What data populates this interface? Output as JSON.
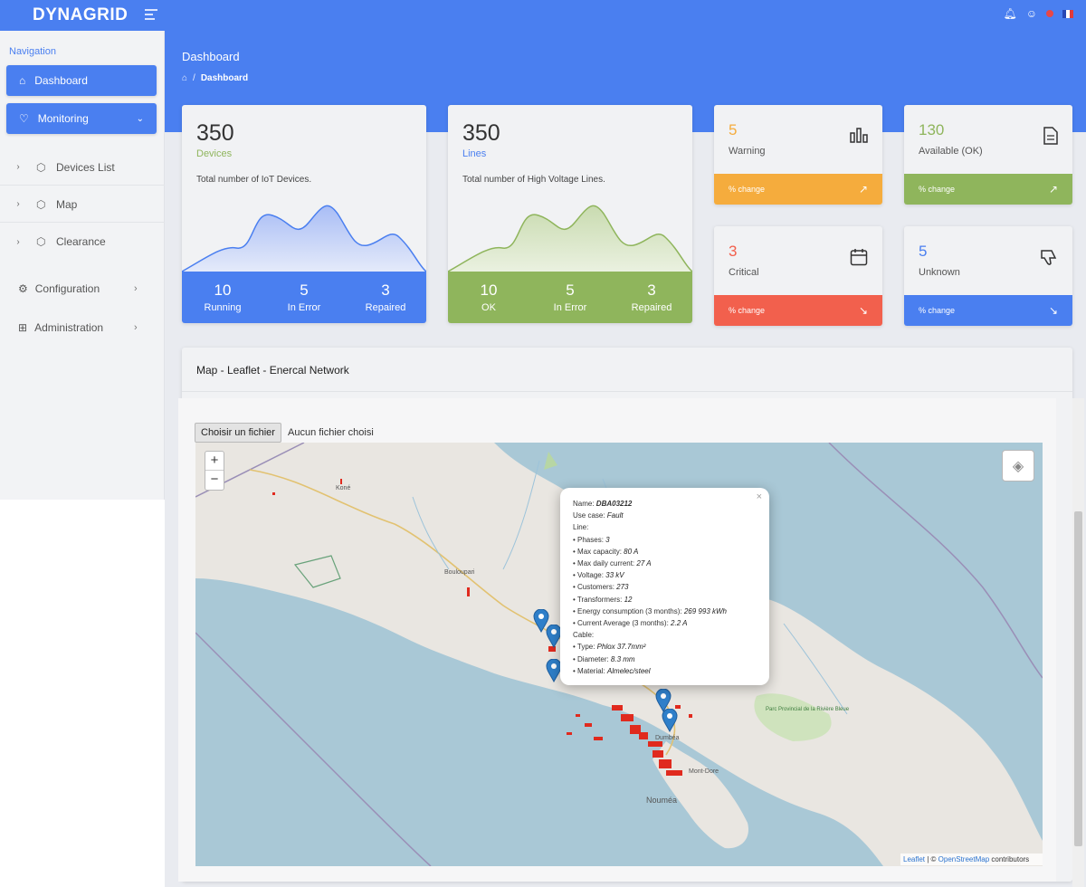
{
  "header": {
    "brand": "DYNAGRID"
  },
  "sidebar": {
    "section_title": "Navigation",
    "dashboard_label": "Dashboard",
    "monitoring_label": "Monitoring",
    "sub_items": [
      {
        "label": "Devices List"
      },
      {
        "label": "Map"
      },
      {
        "label": "Clearance"
      }
    ],
    "configuration_label": "Configuration",
    "administration_label": "Administration"
  },
  "page": {
    "title": "Dashboard",
    "breadcrumb_separator": "/",
    "breadcrumb_current": "Dashboard"
  },
  "cards": {
    "devices": {
      "value": "350",
      "label": "Devices",
      "description": "Total number of IoT Devices.",
      "stats": [
        {
          "value": "10",
          "label": "Running"
        },
        {
          "value": "5",
          "label": "In Error"
        },
        {
          "value": "3",
          "label": "Repaired"
        }
      ],
      "color": "#4a7ff0"
    },
    "lines": {
      "value": "350",
      "label": "Lines",
      "description": "Total number of High Voltage Lines.",
      "stats": [
        {
          "value": "10",
          "label": "OK"
        },
        {
          "value": "5",
          "label": "In Error"
        },
        {
          "value": "3",
          "label": "Repaired"
        }
      ],
      "color": "#8fb55c"
    },
    "warning": {
      "value": "5",
      "label": "Warning",
      "change": "% change",
      "color": "#f5ac3d",
      "icon": "bar-chart-icon"
    },
    "available": {
      "value": "130",
      "label": "Available (OK)",
      "change": "% change",
      "color": "#8fb55c",
      "icon": "document-icon"
    },
    "critical": {
      "value": "3",
      "label": "Critical",
      "change": "% change",
      "color": "#f2604d",
      "icon": "calendar-icon"
    },
    "unknown": {
      "value": "5",
      "label": "Unknown",
      "change": "% change",
      "color": "#4a7ff0",
      "icon": "thumbs-down-icon"
    }
  },
  "map": {
    "title": "Map - Leaflet - Enercal Network",
    "file_button": "Choisir un fichier",
    "file_status": "Aucun fichier choisi",
    "zoom_in": "+",
    "zoom_out": "−",
    "attribution_link1": "Leaflet",
    "attribution_sep": " | © ",
    "attribution_link2": "OpenStreetMap",
    "attribution_rest": " contributors",
    "places": [
      "Koné",
      "Bouloupari",
      "Dumbéa",
      "Mont-Dore",
      "Nouméa",
      "Parc Provincial de la Rivière Bleue"
    ],
    "popup": {
      "name_label": "Name: ",
      "name_value": "DBA03212",
      "use_case_label": "Use case: ",
      "use_case_value": "Fault",
      "line_heading": "Line:",
      "line_items": [
        {
          "label": "• Phases: ",
          "value": "3"
        },
        {
          "label": "• Max capacity: ",
          "value": "80 A"
        },
        {
          "label": "• Max daily current: ",
          "value": "27 A"
        },
        {
          "label": "• Voltage: ",
          "value": "33 kV"
        },
        {
          "label": "• Customers: ",
          "value": "273"
        },
        {
          "label": "• Transformers: ",
          "value": "12"
        },
        {
          "label": "• Energy consumption (3 months): ",
          "value": "269 993 kWh"
        },
        {
          "label": "• Current Average (3 months): ",
          "value": "2.2 A"
        }
      ],
      "cable_heading": "Cable:",
      "cable_items": [
        {
          "label": "• Type: ",
          "value": "Phlox 37.7mm²"
        },
        {
          "label": "• Diameter: ",
          "value": "8.3 mm"
        },
        {
          "label": "• Material: ",
          "value": "Almelec/steel"
        }
      ],
      "close": "×"
    }
  }
}
